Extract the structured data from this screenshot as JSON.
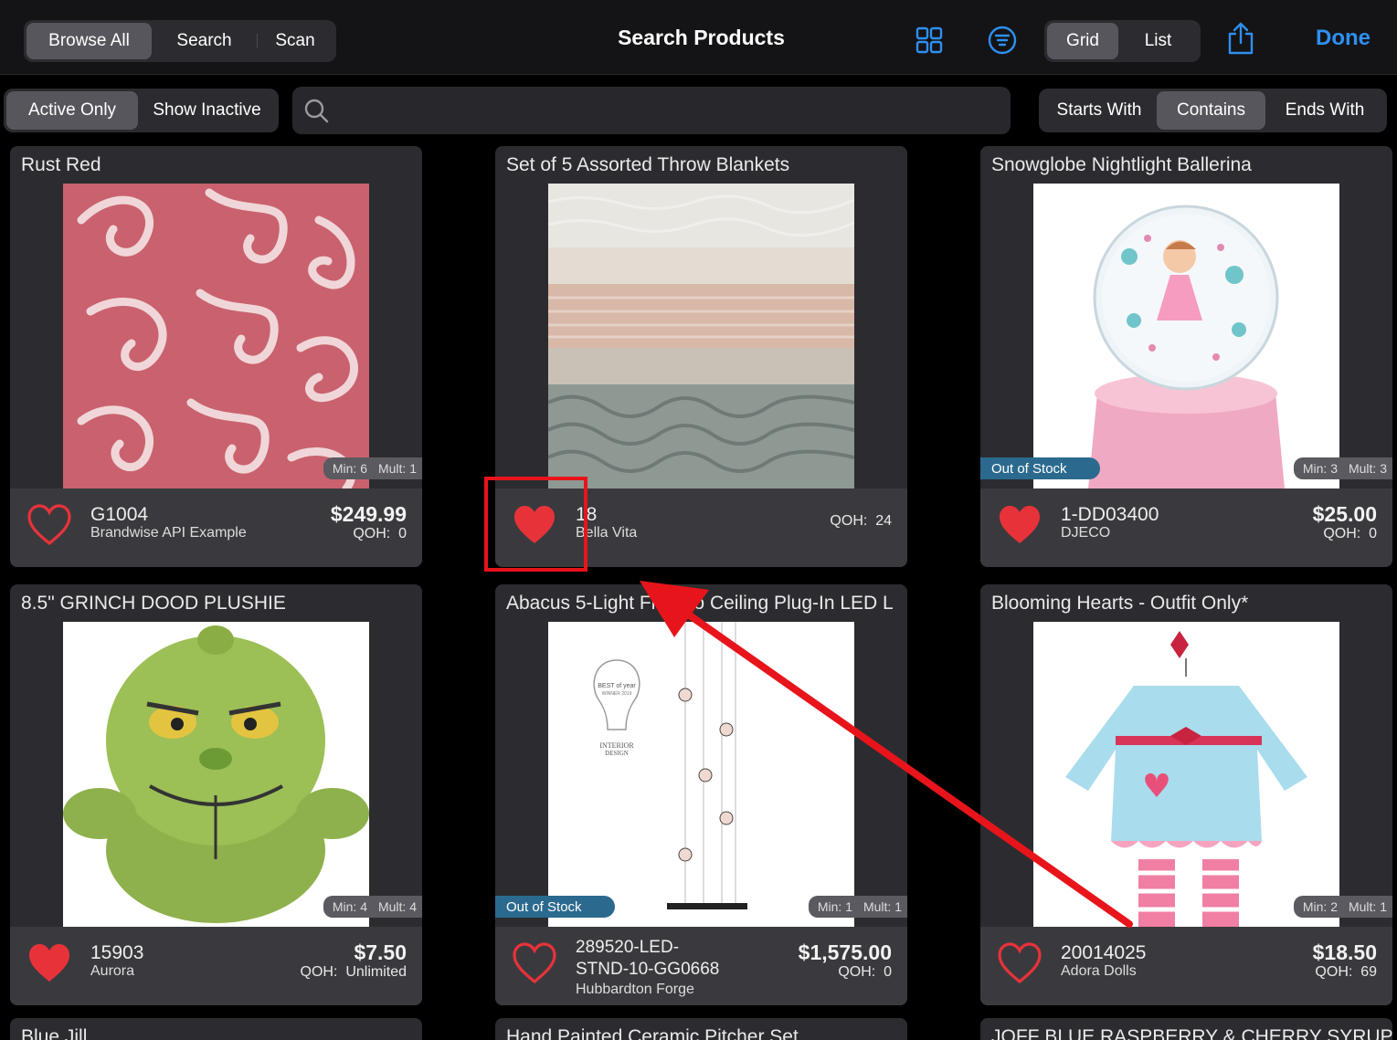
{
  "toolbar": {
    "mode_tabs": [
      "Browse All",
      "Search",
      "Scan"
    ],
    "title": "Search Products",
    "view_tabs": [
      "Grid",
      "List"
    ],
    "done_label": "Done"
  },
  "filters": {
    "active_tabs": [
      "Active Only",
      "Show Inactive"
    ],
    "search_placeholder": "",
    "match_tabs": [
      "Starts With",
      "Contains",
      "Ends With"
    ]
  },
  "products": [
    {
      "title": "Rust Red",
      "sku": "G1004",
      "brand": "Brandwise API Example",
      "price": "$249.99",
      "qoh_label": "QOH:",
      "qoh": "0",
      "min": "Min: 6",
      "mult": "Mult: 1",
      "favorite": false,
      "status": ""
    },
    {
      "title": "Set of 5 Assorted Throw Blankets",
      "sku": "18",
      "brand": "Bella Vita",
      "price": "",
      "qoh_label": "QOH:",
      "qoh": "24",
      "min": "",
      "mult": "",
      "favorite": true,
      "status": ""
    },
    {
      "title": "Snowglobe Nightlight Ballerina",
      "sku": "1-DD03400",
      "brand": "DJECO",
      "price": "$25.00",
      "qoh_label": "QOH:",
      "qoh": "0",
      "min": "Min: 3",
      "mult": "Mult: 3",
      "favorite": true,
      "status": "Out of Stock"
    },
    {
      "title": "8.5\" GRINCH DOOD PLUSHIE",
      "sku": "15903",
      "brand": "Aurora",
      "price": "$7.50",
      "qoh_label": "QOH:",
      "qoh": "Unlimited",
      "min": "Min: 4",
      "mult": "Mult: 4",
      "favorite": true,
      "status": ""
    },
    {
      "title": "Abacus 5-Light Floor to Ceiling Plug-In LED L",
      "sku_line1": "289520-LED-",
      "sku_line2": "STND-10-GG0668",
      "brand": "Hubbardton Forge",
      "price": "$1,575.00",
      "qoh_label": "QOH:",
      "qoh": "0",
      "min": "Min: 1",
      "mult": "Mult: 1",
      "favorite": false,
      "status": "Out of Stock"
    },
    {
      "title": "Blooming Hearts - Outfit Only*",
      "sku": "20014025",
      "brand": "Adora Dolls",
      "price": "$18.50",
      "qoh_label": "QOH:",
      "qoh": "69",
      "min": "Min: 2",
      "mult": "Mult: 1",
      "favorite": false,
      "status": ""
    }
  ],
  "peek_titles": [
    "Blue Jill",
    "Hand Painted Ceramic Pitcher Set",
    "JOFF BLUE RASPBERRY & CHERRY SYRUP GL"
  ],
  "lamp_badge": {
    "line1": "BEST of year",
    "line2": "WINNER 2019",
    "brand1": "INTERIOR",
    "brand2": "DESIGN"
  },
  "colors": {
    "accent": "#2f8ff0",
    "heart": "#e8323a",
    "annotation": "#e8141b",
    "out_of_stock": "#2b6a8e"
  }
}
